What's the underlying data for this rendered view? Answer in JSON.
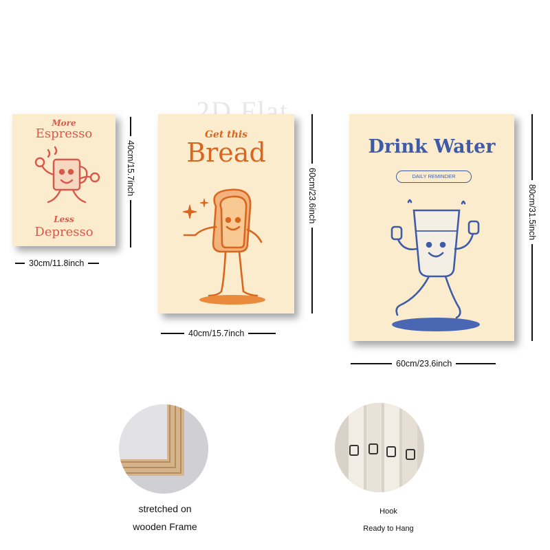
{
  "watermark": "2D Flat",
  "posters": [
    {
      "id": "espresso",
      "line1": "More",
      "line2": "Espresso",
      "line3": "Less",
      "line4": "Depresso",
      "color": "#d9584a",
      "width_label": "30cm/11.8inch",
      "height_label": "40cm/15.7inch"
    },
    {
      "id": "bread",
      "line1": "Get this",
      "line2": "Bread",
      "color": "#d9661f",
      "width_label": "40cm/15.7inch",
      "height_label": "60cm/23.6inch"
    },
    {
      "id": "water",
      "line1": "Drink Water",
      "line2": "DAILY REMINDER",
      "color": "#3f5ba8",
      "width_label": "60cm/23.6inch",
      "height_label": "80cm/31.5inch"
    }
  ],
  "features": [
    {
      "caption_line1": "stretched on",
      "caption_line2": "wooden Frame"
    },
    {
      "caption_line1": "Hook",
      "caption_line2": "Ready to Hang"
    }
  ],
  "colors": {
    "background": "#ffffff",
    "canvas": "#fbeccd",
    "wood": "#d9b892"
  }
}
